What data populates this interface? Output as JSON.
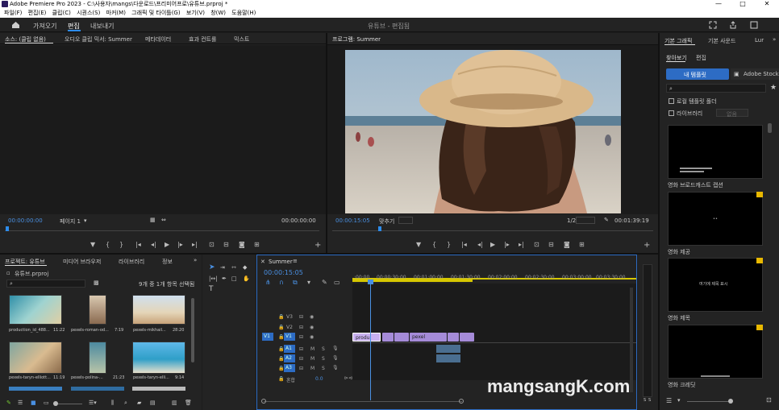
{
  "window": {
    "title": "Adobe Premiere Pro 2023 - C:\\사용자\\mangs\\다운로드\\프리미어프로\\유튜브.prproj *",
    "controls": [
      "—",
      "□",
      "✕"
    ]
  },
  "menu": [
    "파일(F)",
    "편집(E)",
    "클립(C)",
    "시퀀스(S)",
    "마커(M)",
    "그래픽 및 타이틀(G)",
    "보기(V)",
    "창(W)",
    "도움말(H)"
  ],
  "workspace": {
    "tabs": [
      "가져오기",
      "편집",
      "내보내기"
    ],
    "active_tab": "편집",
    "center_title": "유튜브 - 편집됨"
  },
  "source_panel": {
    "tabs": [
      "소스: (클립 없음)",
      "오디오 클립 믹서: Summer",
      "메타데이터",
      "효과 컨트롤",
      "믹스트"
    ],
    "timecode_left": "00:00:00:00",
    "page": "페이지 1",
    "timecode_right": "00:00:00:00"
  },
  "program_panel": {
    "title": "프로그램: Summer",
    "timecode": "00:00:15:05",
    "fit": "맞추기",
    "resolution": "1/2",
    "duration": "00:01:39:19"
  },
  "graphics_panel": {
    "tabs": [
      "기본 그래픽",
      "기본 사운드",
      "Lur"
    ],
    "subtabs": [
      "찾아보기",
      "편집"
    ],
    "buttons": [
      "내 템플릿",
      "Adobe Stock"
    ],
    "checkboxes": [
      "로컬 템플릿 폴더",
      "라이브러리"
    ],
    "library_select": "없음",
    "templates": [
      {
        "label": "영화 브로드캐스트 캡션",
        "preview": ""
      },
      {
        "label": "영화 제공",
        "preview": "••"
      },
      {
        "label": "영화 제목",
        "preview": "여기에 제목 표시"
      },
      {
        "label": "영화 크레딧",
        "preview": ""
      }
    ]
  },
  "project_panel": {
    "tabs": [
      "프로젝트: 유튜브",
      "미디어 브라우저",
      "라이브러리",
      "정보"
    ],
    "file": "유튜브.prproj",
    "selection": "9개 중 1개 항목 선택됨",
    "items": [
      {
        "name": "production_id_488...",
        "duration": "11:22"
      },
      {
        "name": "pexels-roman-od...",
        "duration": "7:19"
      },
      {
        "name": "pexels-mikhail...",
        "duration": "28:20"
      },
      {
        "name": "pexels-taryn-elliott...",
        "duration": "11:19"
      },
      {
        "name": "pexels-polina-...",
        "duration": "21:23"
      },
      {
        "name": "pexels-taryn-elli...",
        "duration": "9:14"
      }
    ]
  },
  "timeline": {
    "sequence": "Summer",
    "timecode": "00:00:15:05",
    "ruler": [
      ":00:00",
      "00:00:30:00",
      "00:01:00:00",
      "00:01:30:00",
      "00:02:00:00",
      "00:02:30:00",
      "00:03:00:00",
      "00:03:30:00"
    ],
    "video_tracks": [
      "V3",
      "V2",
      "V1"
    ],
    "audio_tracks": [
      "A1",
      "A2",
      "A3"
    ],
    "mix_label": "혼합",
    "mix_value": "0.0",
    "clip_labels": [
      "produ",
      "pexel"
    ],
    "source_patch_v": "V1",
    "source_patch_a": "A1"
  },
  "meter": {
    "labels": [
      "S",
      "S"
    ]
  },
  "watermark": "mangsangK.com"
}
